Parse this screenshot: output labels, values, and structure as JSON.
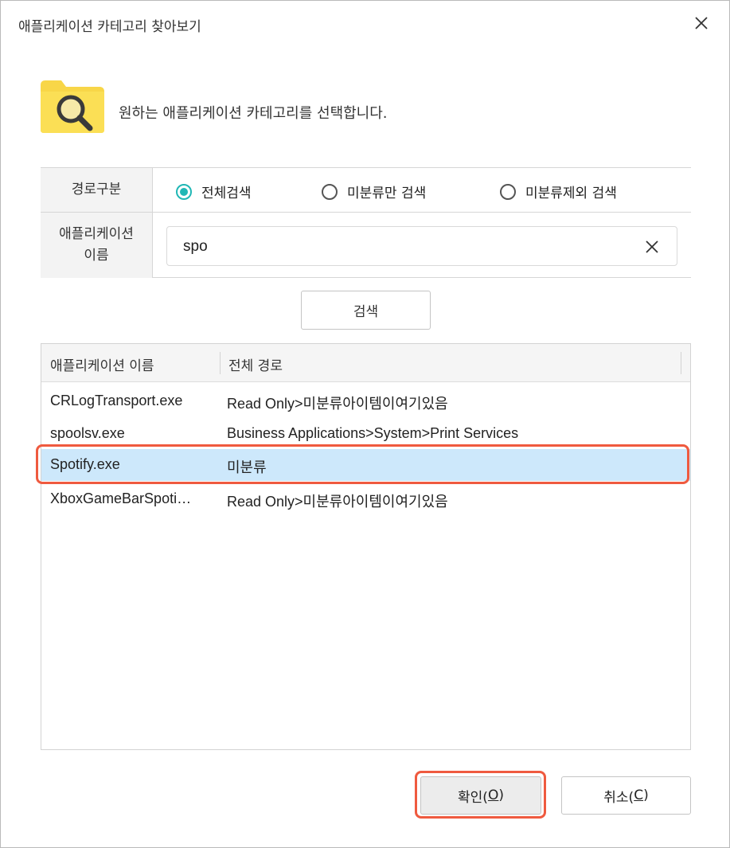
{
  "window": {
    "title": "애플리케이션 카테고리 찾아보기",
    "close_icon": "close-icon"
  },
  "header": {
    "icon": "folder-search-icon",
    "instruction": "원하는 애플리케이션 카테고리를 선택합니다."
  },
  "form": {
    "path_type_label": "경로구분",
    "radios": [
      {
        "label": "전체검색",
        "checked": true
      },
      {
        "label": "미분류만 검색",
        "checked": false
      },
      {
        "label": "미분류제외 검색",
        "checked": false
      }
    ],
    "app_name_label_line1": "애플리케이션",
    "app_name_label_line2": "이름",
    "search_value": "spo"
  },
  "search_button": "검색",
  "list": {
    "columns": [
      "애플리케이션 이름",
      "전체 경로"
    ],
    "rows": [
      {
        "name": "CRLogTransport.exe",
        "path": "Read Only>미분류아이템이여기있음",
        "selected": false
      },
      {
        "name": "spoolsv.exe",
        "path": "Business Applications>System>Print Services",
        "selected": false
      },
      {
        "name": "Spotify.exe",
        "path": "미분류",
        "selected": true
      },
      {
        "name": "XboxGameBarSpoti…",
        "path": "Read Only>미분류아이템이여기있음",
        "selected": false
      }
    ]
  },
  "buttons": {
    "ok_text": "확인(",
    "ok_mnemonic": "O",
    "ok_close": ")",
    "cancel_text": "취소(",
    "cancel_mnemonic": "C",
    "cancel_close": ")"
  },
  "colors": {
    "accent_radio": "#20b7b5",
    "selection_bg": "#cde8fb",
    "highlight_border": "#ef5a3f",
    "folder_yellow": "#f8d648"
  }
}
